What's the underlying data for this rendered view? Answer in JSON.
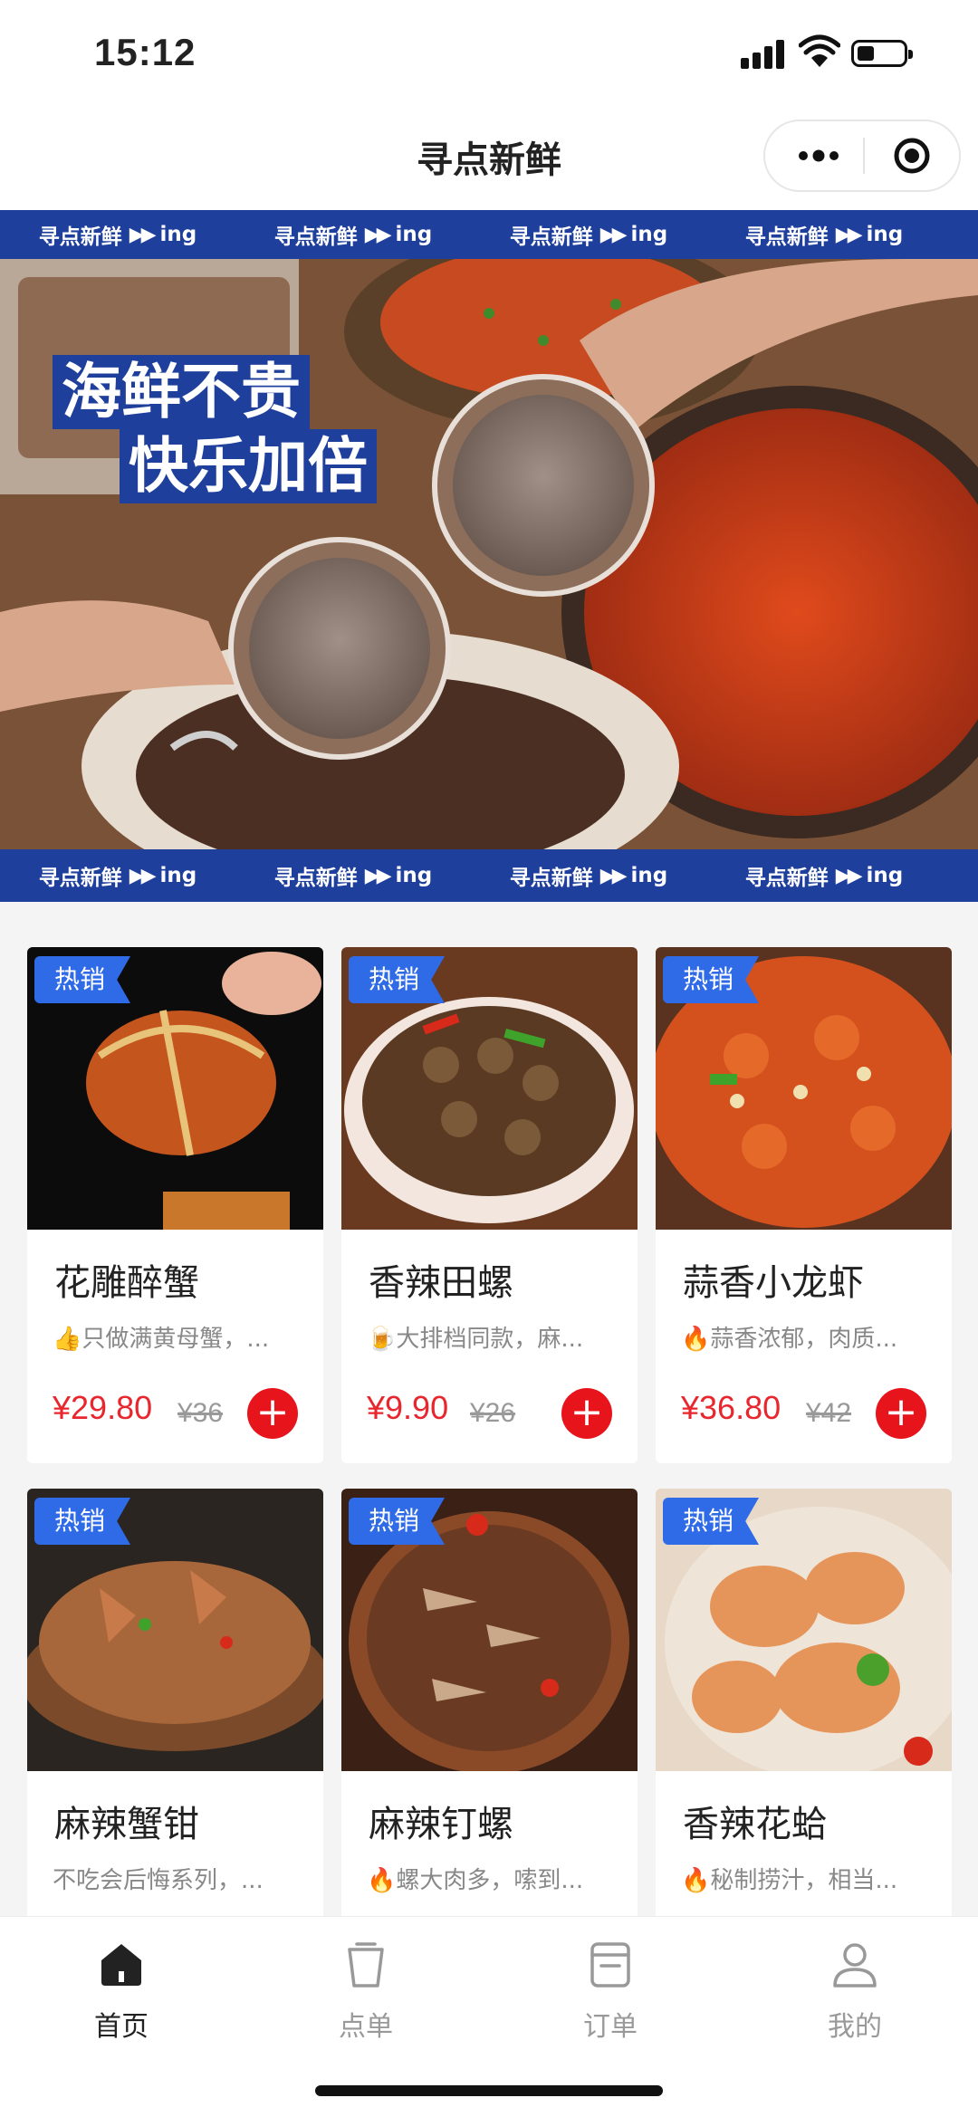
{
  "status": {
    "time": "15:12"
  },
  "nav": {
    "title": "寻点新鲜"
  },
  "banner": {
    "ticker": [
      {
        "brand": "寻点新鲜",
        "arrows": "▶▶",
        "suffix": "ing"
      },
      {
        "brand": "寻点新鲜",
        "arrows": "▶▶",
        "suffix": "ing"
      },
      {
        "brand": "寻点新鲜",
        "arrows": "▶▶",
        "suffix": "ing"
      },
      {
        "brand": "寻点新鲜",
        "arrows": "▶▶",
        "suffix": "ing"
      }
    ],
    "slogan_line1": "海鲜不贵",
    "slogan_line2": "快乐加倍"
  },
  "products": [
    {
      "tag": "热销",
      "name": "花雕醉蟹",
      "desc": "👍只做满黄母蟹，...",
      "price": "¥29.80",
      "orig": "¥36",
      "add": "+"
    },
    {
      "tag": "热销",
      "name": "香辣田螺",
      "desc": "🍺大排档同款，麻...",
      "price": "¥9.90",
      "orig": "¥26",
      "add": "+"
    },
    {
      "tag": "热销",
      "name": "蒜香小龙虾",
      "desc": "🔥蒜香浓郁，肉质...",
      "price": "¥36.80",
      "orig": "¥42",
      "add": "+"
    },
    {
      "tag": "热销",
      "name": "麻辣蟹钳",
      "desc": "不吃会后悔系列，...",
      "price": "",
      "orig": "",
      "add": ""
    },
    {
      "tag": "热销",
      "name": "麻辣钉螺",
      "desc": "🔥螺大肉多，嗦到...",
      "price": "",
      "orig": "",
      "add": ""
    },
    {
      "tag": "热销",
      "name": "香辣花蛤",
      "desc": "🔥秘制捞汁，相当...",
      "price": "",
      "orig": "",
      "add": ""
    }
  ],
  "tabbar": [
    {
      "label": "首页",
      "icon": "home-icon",
      "active": true
    },
    {
      "label": "点单",
      "icon": "cup-icon",
      "active": false
    },
    {
      "label": "订单",
      "icon": "order-icon",
      "active": false
    },
    {
      "label": "我的",
      "icon": "user-icon",
      "active": false
    }
  ],
  "colors": {
    "brand_blue": "#1e3f9c",
    "tag_blue": "#2f6be7",
    "price_red": "#e8262e"
  }
}
